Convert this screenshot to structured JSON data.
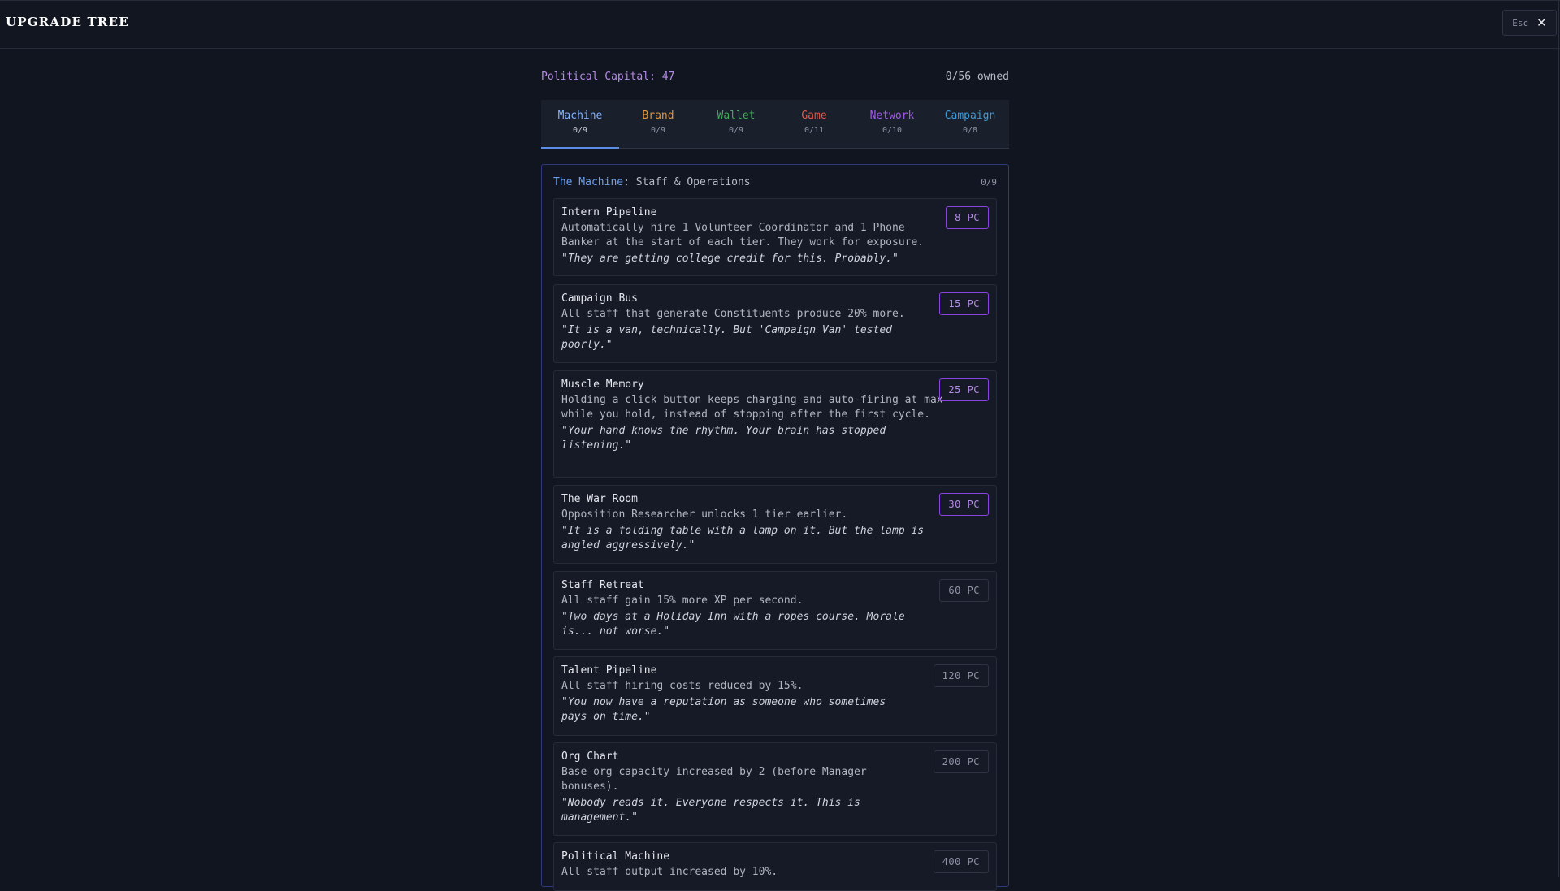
{
  "header": {
    "title": "UPGRADE TREE",
    "esc_label": "Esc"
  },
  "status": {
    "political_capital": "Political Capital: 47",
    "owned": "0/56 owned"
  },
  "tabs": [
    {
      "label": "Machine",
      "count": "0/9",
      "color": "#7fb2ff"
    },
    {
      "label": "Brand",
      "count": "0/9",
      "color": "#e0963c"
    },
    {
      "label": "Wallet",
      "count": "0/9",
      "color": "#3fae5a"
    },
    {
      "label": "Game",
      "count": "0/11",
      "color": "#e0594a"
    },
    {
      "label": "Network",
      "count": "0/10",
      "color": "#a05ae6"
    },
    {
      "label": "Campaign",
      "count": "0/8",
      "color": "#3c9ad6"
    }
  ],
  "panel": {
    "name": "The Machine",
    "subtitle": ": Staff & Operations",
    "count": "0/9"
  },
  "upgrades": [
    {
      "title": "Intern Pipeline",
      "desc": "Automatically hire 1 Volunteer Coordinator and 1 Phone Banker at the start of each tier. They work for exposure.",
      "quote": "\"They are getting college credit for this. Probably.\"",
      "cost": "8 PC",
      "affordable": true
    },
    {
      "title": "Campaign Bus",
      "desc": "All staff that generate Constituents produce 20% more.",
      "quote": "\"It is a van, technically. But 'Campaign Van' tested poorly.\"",
      "cost": "15 PC",
      "affordable": true
    },
    {
      "title": "Muscle Memory",
      "desc": "Holding a click button keeps charging and auto-firing at max while you hold, instead of stopping after the first cycle.",
      "quote": "\"Your hand knows the rhythm. Your brain has stopped listening.\"",
      "cost": "25 PC",
      "affordable": true
    },
    {
      "title": "The War Room",
      "desc": "Opposition Researcher unlocks 1 tier earlier.",
      "quote": "\"It is a folding table with a lamp on it. But the lamp is angled aggressively.\"",
      "cost": "30 PC",
      "affordable": true
    },
    {
      "title": "Staff Retreat",
      "desc": "All staff gain 15% more XP per second.",
      "quote": "\"Two days at a Holiday Inn with a ropes course. Morale is... not worse.\"",
      "cost": "60 PC",
      "affordable": false
    },
    {
      "title": "Talent Pipeline",
      "desc": "All staff hiring costs reduced by 15%.",
      "quote": "\"You now have a reputation as someone who sometimes pays on time.\"",
      "cost": "120 PC",
      "affordable": false
    },
    {
      "title": "Org Chart",
      "desc": "Base org capacity increased by 2 (before Manager bonuses).",
      "quote": "\"Nobody reads it. Everyone respects it. This is management.\"",
      "cost": "200 PC",
      "affordable": false
    },
    {
      "title": "Political Machine",
      "desc": "All staff output increased by 10%.",
      "quote": "",
      "cost": "400 PC",
      "affordable": false
    }
  ]
}
